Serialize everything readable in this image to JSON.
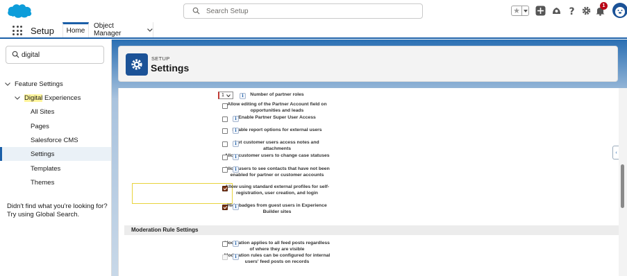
{
  "header": {
    "search_placeholder": "Search Setup",
    "notification_count": "1",
    "icons": [
      "salesforce-cloud-logo",
      "star-icon",
      "add-icon",
      "trailhead-icon",
      "help-icon",
      "gear-icon",
      "bell-icon",
      "avatar"
    ]
  },
  "context": {
    "app_name": "Setup",
    "tabs": [
      "Home",
      "Object Manager"
    ]
  },
  "sidebar": {
    "search_value": "digital",
    "tree": {
      "feature_settings": "Feature Settings",
      "digital_highlight": "Digital",
      "digital_rest": " Experiences",
      "children": [
        "All Sites",
        "Pages",
        "Salesforce CMS",
        "Settings",
        "Templates",
        "Themes"
      ]
    },
    "help_text": "Didn't find what you're looking for? Try using Global Search."
  },
  "page": {
    "eyebrow": "SETUP",
    "title": "Settings"
  },
  "settings": {
    "number_of_partner_roles_label": "Number of partner roles",
    "number_of_partner_roles_value": "1",
    "rows": [
      {
        "label": "Allow editing of the Partner Account field on opportunities and leads",
        "checked": false
      },
      {
        "label": "Enable Partner Super User Access",
        "checked": false
      },
      {
        "label": "Enable report options for external users",
        "checked": false
      },
      {
        "label": "Let customer users access notes and attachments",
        "checked": false
      },
      {
        "label": "Allow customer users to change case statuses",
        "checked": false
      },
      {
        "label": "Allow users to see contacts that have not been enabled for partner or customer accounts",
        "checked": false
      },
      {
        "label": "Allow using standard external profiles for self-registration, user creation, and login",
        "checked": true
      },
      {
        "label": "Hide badges from guest users in Experience Builder sites",
        "checked": true
      }
    ],
    "section_moderation": "Moderation Rule Settings",
    "moderation_rows": [
      {
        "label": "Moderation applies to all feed posts regardless of where they are visible",
        "checked": false
      },
      {
        "label": "Moderation rules can be configured for internal users' feed posts on records",
        "checked": false
      }
    ]
  },
  "colors": {
    "brand_blue": "#1b5fa8",
    "checkbox_checked": "#7b3515",
    "highlight_box": "#e8d33c"
  }
}
